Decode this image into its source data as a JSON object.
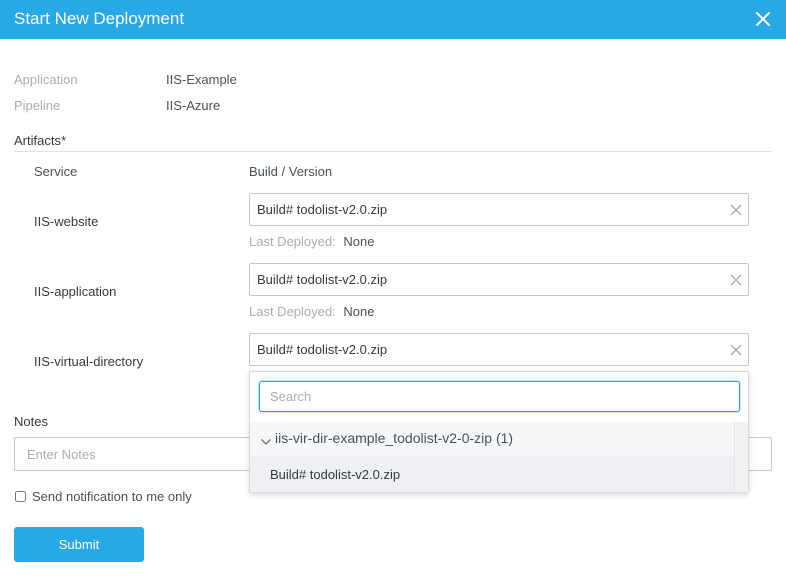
{
  "dialog": {
    "title": "Start New Deployment"
  },
  "meta": {
    "application_label": "Application",
    "application_value": "IIS-Example",
    "pipeline_label": "Pipeline",
    "pipeline_value": "IIS-Azure"
  },
  "artifacts": {
    "section_title": "Artifacts*",
    "col_service": "Service",
    "col_build": "Build / Version",
    "last_deployed_label": "Last Deployed:",
    "rows": [
      {
        "service": "IIS-website",
        "build": "Build# todolist-v2.0.zip",
        "last_deployed": "None"
      },
      {
        "service": "IIS-application",
        "build": "Build# todolist-v2.0.zip",
        "last_deployed": "None"
      },
      {
        "service": "IIS-virtual-directory",
        "build": "Build# todolist-v2.0.zip"
      }
    ]
  },
  "dropdown": {
    "search_placeholder": "Search",
    "group_label": "iis-vir-dir-example_todolist-v2-0-zip (1)",
    "option_label": "Build# todolist-v2.0.zip"
  },
  "notes": {
    "label": "Notes",
    "placeholder": "Enter Notes"
  },
  "notify": {
    "label": "Send notification to me only",
    "checked": false
  },
  "submit": {
    "label": "Submit"
  },
  "colors": {
    "accent": "#29a8e6",
    "focus_border": "#2f9fd8"
  }
}
